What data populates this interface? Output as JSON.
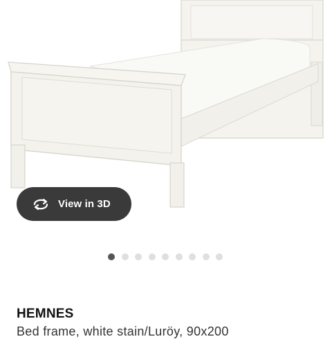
{
  "product": {
    "image_alt": "white single bed frame",
    "view_3d_label": "View in 3D",
    "view_3d_icon": "rotate-arrows-icon",
    "carousel": {
      "total": 9,
      "active": 1
    },
    "name": "HEMNES",
    "description": "Bed frame, white stain/Luröy, 90x200"
  }
}
